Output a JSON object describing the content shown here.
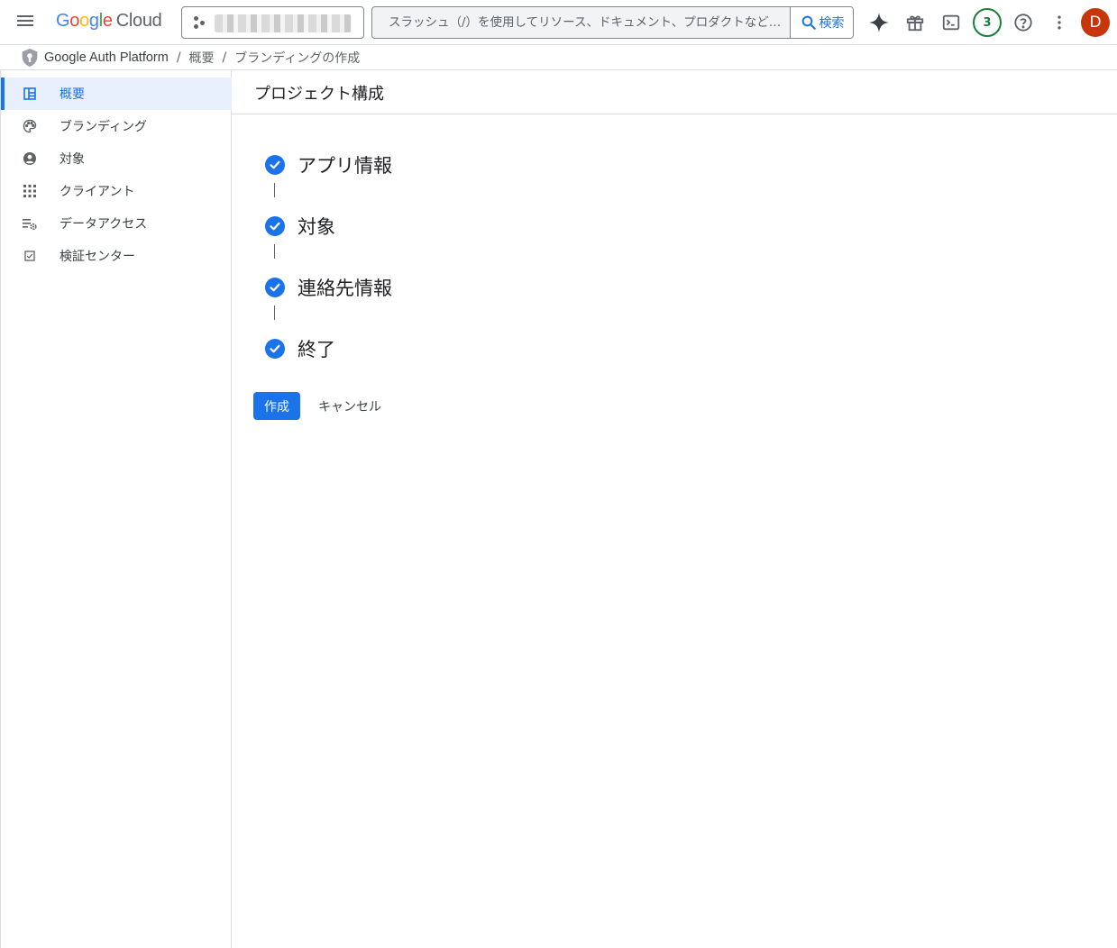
{
  "topbar": {
    "logo_parts": [
      "G",
      "o",
      "o",
      "g",
      "l",
      "e"
    ],
    "logo_product": "Cloud",
    "search_placeholder": "スラッシュ（/）を使用してリソース、ドキュメント、プロダクトなど…",
    "search_button_label": "検索",
    "notification_count": "3",
    "avatar_initial": "D",
    "icons": [
      "menu-icon",
      "project-picker-icon",
      "search-icon",
      "gemini-sparkle-icon",
      "gift-icon",
      "cloud-shell-icon",
      "help-icon",
      "more-vert-icon"
    ]
  },
  "breadcrumb": {
    "product": "Google Auth Platform",
    "items": [
      "概要",
      "ブランディングの作成"
    ],
    "separator": "/"
  },
  "sidebar": {
    "items": [
      {
        "label": "概要",
        "icon": "dashboard-icon",
        "active": true
      },
      {
        "label": "ブランディング",
        "icon": "palette-icon",
        "active": false
      },
      {
        "label": "対象",
        "icon": "account-circle-icon",
        "active": false
      },
      {
        "label": "クライアント",
        "icon": "apps-grid-icon",
        "active": false
      },
      {
        "label": "データアクセス",
        "icon": "data-settings-icon",
        "active": false
      },
      {
        "label": "検証センター",
        "icon": "verified-checkbox-icon",
        "active": false
      }
    ]
  },
  "main": {
    "title": "プロジェクト構成",
    "steps": [
      {
        "label": "アプリ情報",
        "status": "complete"
      },
      {
        "label": "対象",
        "status": "complete"
      },
      {
        "label": "連絡先情報",
        "status": "complete"
      },
      {
        "label": "終了",
        "status": "complete"
      }
    ],
    "create_button": "作成",
    "cancel_button": "キャンセル"
  },
  "colors": {
    "accent": "#1a73e8",
    "active_nav_bg": "#e8f0fe",
    "badge_green": "#188038",
    "avatar_bg": "#c5360b"
  }
}
